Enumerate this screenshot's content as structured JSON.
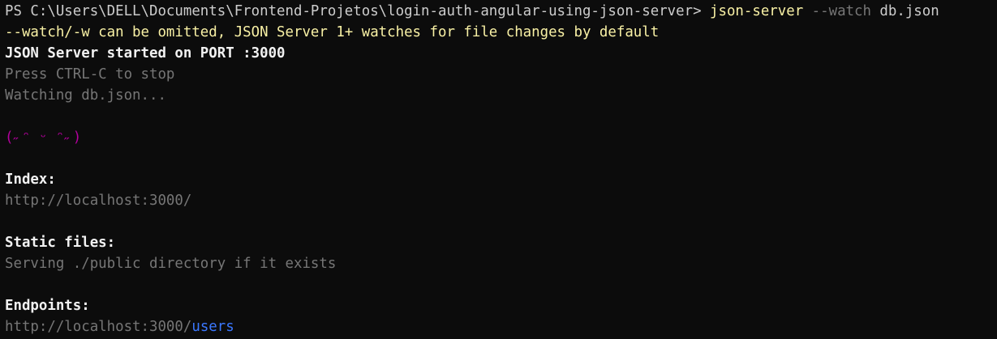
{
  "colors": {
    "background": "#0c0c0c",
    "default": "#cccccc",
    "bright_white": "#f2f2f2",
    "yellow": "#f9f1a5",
    "gray": "#767676",
    "magenta": "#b4009e",
    "blue": "#3b78ff"
  },
  "lines": [
    {
      "name": "prompt-line",
      "segments": [
        {
          "text": "PS C:\\Users\\DELL\\Documents\\Frontend-Projetos\\login-auth-angular-using-json-server> ",
          "color": "#cccccc"
        },
        {
          "text": "json-server",
          "color": "#f9f1a5"
        },
        {
          "text": " --watch",
          "color": "#767676"
        },
        {
          "text": " db.json",
          "color": "#cccccc"
        }
      ]
    },
    {
      "name": "watch-notice-line",
      "segments": [
        {
          "text": "--watch/-w can be omitted, JSON Server 1+ watches for file changes by default",
          "color": "#f9f1a5"
        }
      ]
    },
    {
      "name": "server-started-line",
      "bold": true,
      "segments": [
        {
          "text": "JSON Server started on PORT :3000",
          "color": "#f2f2f2"
        }
      ]
    },
    {
      "name": "stop-hint-line",
      "segments": [
        {
          "text": "Press CTRL-C to stop",
          "color": "#767676"
        }
      ]
    },
    {
      "name": "watching-line",
      "segments": [
        {
          "text": "Watching db.json...",
          "color": "#767676"
        }
      ]
    },
    {
      "name": "blank-line",
      "segments": []
    },
    {
      "name": "kaomoji-line",
      "segments": [
        {
          "text": "(˶ᵔ ᵕ ᵔ˶)",
          "color": "#b4009e"
        }
      ]
    },
    {
      "name": "blank-line",
      "segments": []
    },
    {
      "name": "index-heading",
      "bold": true,
      "segments": [
        {
          "text": "Index:",
          "color": "#f2f2f2"
        }
      ]
    },
    {
      "name": "index-url",
      "segments": [
        {
          "text": "http://localhost:3000/",
          "color": "#767676"
        }
      ]
    },
    {
      "name": "blank-line",
      "segments": []
    },
    {
      "name": "static-files-heading",
      "bold": true,
      "segments": [
        {
          "text": "Static files:",
          "color": "#f2f2f2"
        }
      ]
    },
    {
      "name": "static-files-info",
      "segments": [
        {
          "text": "Serving ./public directory if it exists",
          "color": "#767676"
        }
      ]
    },
    {
      "name": "blank-line",
      "segments": []
    },
    {
      "name": "endpoints-heading",
      "bold": true,
      "segments": [
        {
          "text": "Endpoints:",
          "color": "#f2f2f2"
        }
      ]
    },
    {
      "name": "endpoint-users-url",
      "segments": [
        {
          "text": "http://localhost:3000/",
          "color": "#767676"
        },
        {
          "text": "users",
          "color": "#3b78ff"
        }
      ]
    }
  ]
}
